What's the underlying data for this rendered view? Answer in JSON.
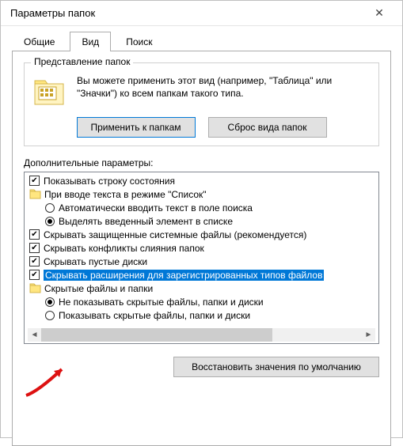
{
  "window": {
    "title": "Параметры папок",
    "close_glyph": "✕"
  },
  "tabs": {
    "general": "Общие",
    "view": "Вид",
    "search": "Поиск"
  },
  "group": {
    "title": "Представление папок",
    "text": "Вы можете применить этот вид (например, \"Таблица\" или \"Значки\") ко всем папкам такого типа.",
    "apply_btn": "Применить к папкам",
    "reset_btn": "Сброс вида папок"
  },
  "adv_label": "Дополнительные параметры:",
  "tree": [
    {
      "type": "check",
      "checked": true,
      "indent": 0,
      "label": "Показывать строку состояния"
    },
    {
      "type": "folder",
      "indent": 0,
      "label": "При вводе текста в режиме \"Список\""
    },
    {
      "type": "radio",
      "selected": false,
      "indent": 1,
      "label": "Автоматически вводить текст в поле поиска"
    },
    {
      "type": "radio",
      "selected": true,
      "indent": 1,
      "label": "Выделять введенный элемент в списке"
    },
    {
      "type": "check",
      "checked": true,
      "indent": 0,
      "label": "Скрывать защищенные системные файлы (рекомендуется)"
    },
    {
      "type": "check",
      "checked": true,
      "indent": 0,
      "label": "Скрывать конфликты слияния папок"
    },
    {
      "type": "check",
      "checked": true,
      "indent": 0,
      "label": "Скрывать пустые диски"
    },
    {
      "type": "check",
      "checked": true,
      "indent": 0,
      "selected_row": true,
      "label": "Скрывать расширения для зарегистрированных типов файлов"
    },
    {
      "type": "folder",
      "indent": 0,
      "label": "Скрытые файлы и папки"
    },
    {
      "type": "radio",
      "selected": true,
      "indent": 1,
      "label": "Не показывать скрытые файлы, папки и диски"
    },
    {
      "type": "radio",
      "selected": false,
      "indent": 1,
      "label": "Показывать скрытые файлы, папки и диски"
    }
  ],
  "restore_btn": "Восстановить значения по умолчанию"
}
